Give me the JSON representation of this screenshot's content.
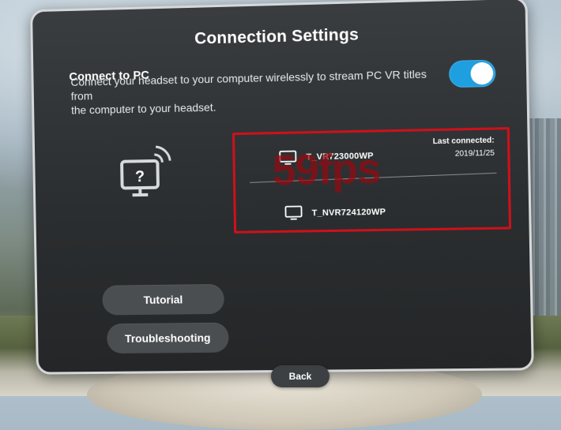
{
  "panel": {
    "title": "Connection Settings"
  },
  "connect_to_pc": {
    "title": "Connect to PC",
    "description_line1": "Connect your headset to your computer wirelessly to stream PC VR titles from",
    "description_line2": "the computer to your headset.",
    "toggle_state": "on",
    "toggle_color": "#1e9fe0"
  },
  "devices": [
    {
      "name": "T_VR723000WP",
      "last_connected_label": "Last connected:",
      "last_connected_date": "2019/11/25",
      "icon": "monitor-icon"
    },
    {
      "name": "T_NVR724120WP",
      "icon": "monitor-icon"
    }
  ],
  "overlay": {
    "fps_text": "59fps",
    "highlight_color": "#d0101a"
  },
  "buttons": {
    "tutorial": "Tutorial",
    "troubleshooting": "Troubleshooting",
    "back": "Back"
  },
  "illustration": {
    "icon": "pc-wireless-question-icon",
    "glyph": "?"
  }
}
